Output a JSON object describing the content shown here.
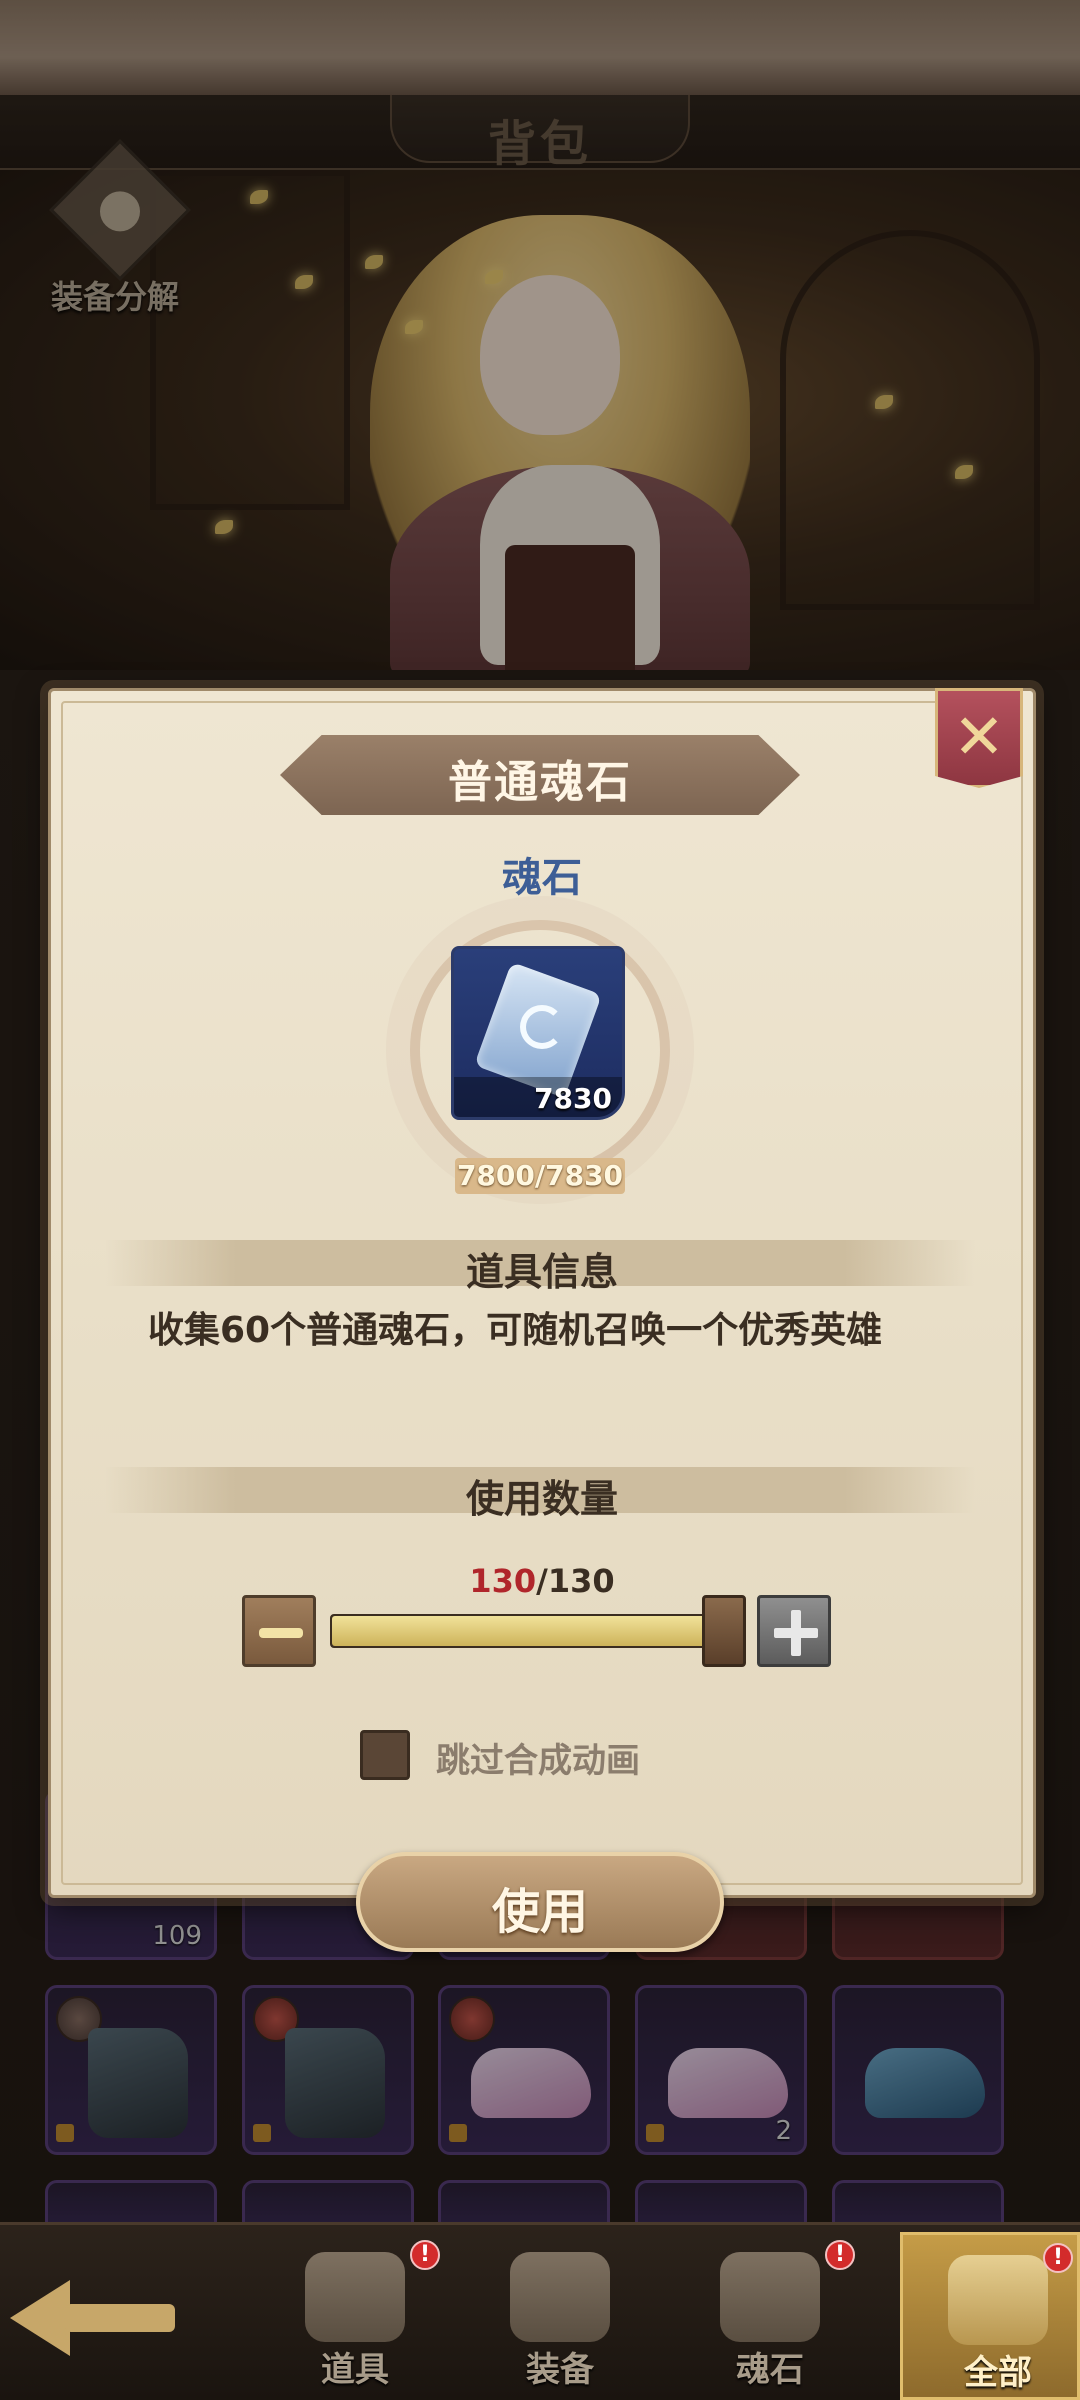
{
  "header": {
    "title": "背包",
    "decompose_label": "装备分解"
  },
  "modal": {
    "item_name": "普通魂石",
    "category": "魂石",
    "icon": "soul-stone-icon",
    "item_count": "7830",
    "progress": "7800/7830",
    "info_section_title": "道具信息",
    "description": "收集60个普通魂石，可随机召唤一个优秀英雄",
    "quantity_section_title": "使用数量",
    "quantity_current": "130",
    "quantity_separator": "/",
    "quantity_max": "130",
    "slider_fraction": 1.0,
    "skip_animation_label": "跳过合成动画",
    "skip_animation_checked": false,
    "use_button_label": "使用",
    "close_icon": "close-icon"
  },
  "grid": {
    "top_row_count": "109",
    "shoe_count": "2"
  },
  "bottom_nav": {
    "back_icon": "back-arrow-icon",
    "tabs": [
      {
        "label": "道具",
        "alert": "!"
      },
      {
        "label": "装备",
        "alert": ""
      },
      {
        "label": "魂石",
        "alert": "!"
      },
      {
        "label": "全部",
        "alert": "!"
      }
    ],
    "active_tab": "全部"
  },
  "colors": {
    "accent_title": "#3d5e96",
    "quantity_current": "#b0262b",
    "alert": "#d32b2b",
    "active_tab": "#c59c47"
  }
}
